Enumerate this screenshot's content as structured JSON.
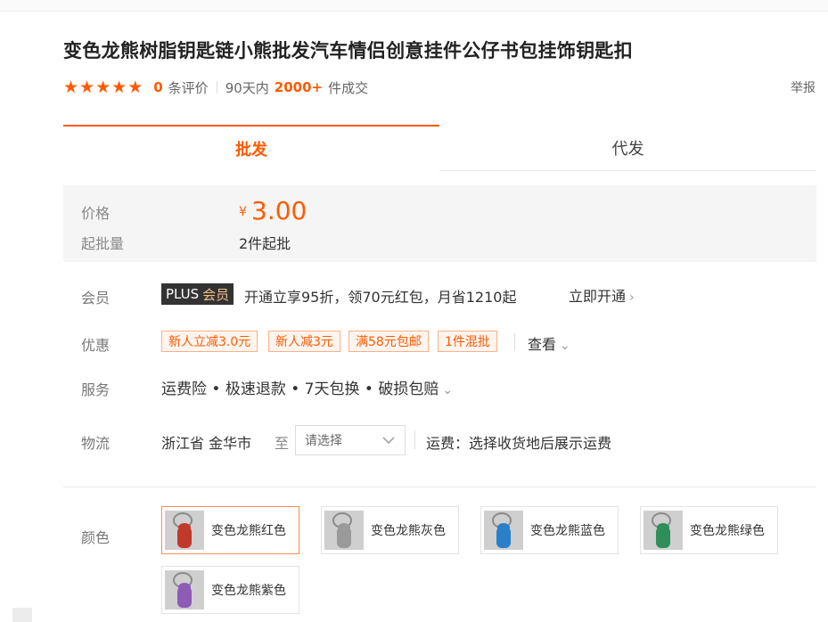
{
  "product": {
    "title": "变色龙熊树脂钥匙链小熊批发汽车情侣创意挂件公仔书包挂饰钥匙扣",
    "review_count": "0",
    "review_suffix": "条评价",
    "sales_prefix": "90天内",
    "sales_count": "2000+",
    "sales_suffix": "件成交",
    "report_label": "举报"
  },
  "tabs": [
    {
      "label": "批发",
      "active": true
    },
    {
      "label": "代发",
      "active": false
    }
  ],
  "price": {
    "label": "价格",
    "currency": "¥",
    "value": "3.00",
    "moq_label": "起批量",
    "moq_value": "2件起批"
  },
  "member": {
    "label": "会员",
    "badge_plus": "PLUS",
    "badge_text": "会员",
    "text": "开通立享95折，领70元红包，月省1210起",
    "link": "立即开通"
  },
  "promo": {
    "label": "优惠",
    "tags": [
      "新人立减3.0元",
      "新人减3元",
      "满58元包邮",
      "1件混批"
    ],
    "more": "查看"
  },
  "service": {
    "label": "服务",
    "text": "运费险 • 极速退款 • 7天包换 • 破损包赔"
  },
  "logistics": {
    "label": "物流",
    "origin": "浙江省 金华市",
    "to": "至",
    "select_placeholder": "请选择",
    "shipping_text": "运费：选择收货地后展示运费"
  },
  "color": {
    "label": "颜色",
    "options": [
      {
        "name": "变色龙熊红色",
        "selected": true,
        "tint": "#c0392b"
      },
      {
        "name": "变色龙熊灰色",
        "selected": false,
        "tint": "#9a9a9a"
      },
      {
        "name": "变色龙熊蓝色",
        "selected": false,
        "tint": "#2a7fc9"
      },
      {
        "name": "变色龙熊绿色",
        "selected": false,
        "tint": "#2f8f5a"
      },
      {
        "name": "变色龙熊紫色",
        "selected": false,
        "tint": "#8e5bb5"
      }
    ]
  },
  "colors": {
    "accent": "#ff5a00",
    "tag_bg": "#fff5ef",
    "tag_border": "#ffb089",
    "price_box_bg": "#f5f5f5"
  }
}
